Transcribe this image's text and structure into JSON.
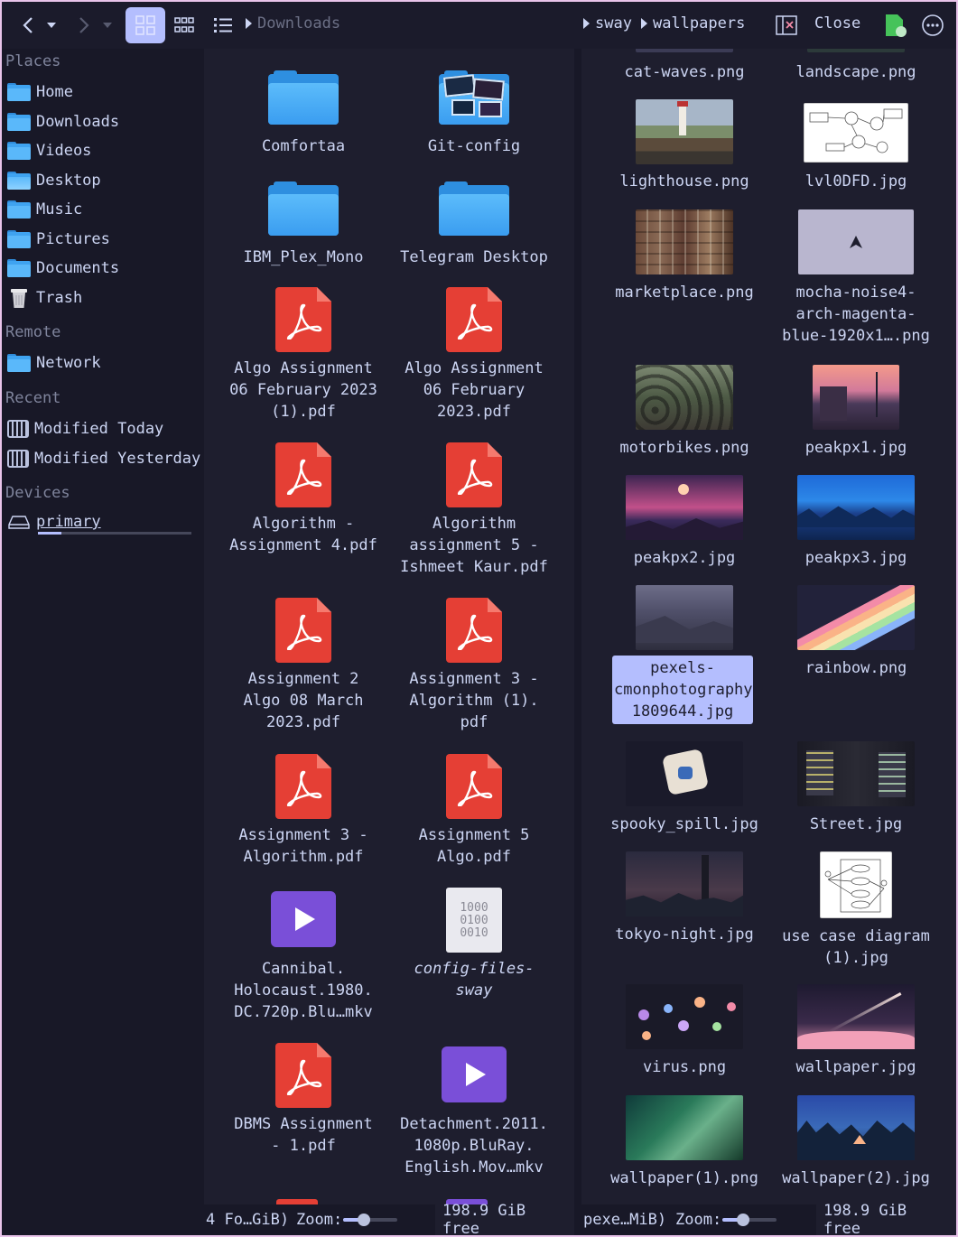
{
  "toolbar": {
    "path_placeholder": "Downloads",
    "crumb_1": "sway",
    "crumb_2": "wallpapers",
    "close_label": "Close"
  },
  "sidebar": {
    "places_header": "Places",
    "places": [
      "Home",
      "Downloads",
      "Videos",
      "Desktop",
      "Music",
      "Pictures",
      "Documents",
      "Trash"
    ],
    "remote_header": "Remote",
    "remote": [
      "Network"
    ],
    "recent_header": "Recent",
    "recent": [
      "Modified Today",
      "Modified Yesterday"
    ],
    "devices_header": "Devices",
    "devices": [
      "primary"
    ],
    "primary_usage": 0.15
  },
  "left_pane": {
    "items": [
      {
        "name": "Comfortaa",
        "type": "folder"
      },
      {
        "name": "Git-config",
        "type": "folder-images"
      },
      {
        "name": "IBM_Plex_Mono",
        "type": "folder"
      },
      {
        "name": "Telegram Desktop",
        "type": "folder"
      },
      {
        "name": "Algo Assignment\n06 February 2023\n(1).pdf",
        "type": "pdf"
      },
      {
        "name": "Algo Assignment\n06 February\n2023.pdf",
        "type": "pdf"
      },
      {
        "name": "Algorithm -\nAssignment 4.pdf",
        "type": "pdf"
      },
      {
        "name": "Algorithm\nassignment 5 -\nIshmeet Kaur.pdf",
        "type": "pdf"
      },
      {
        "name": "Assignment 2\nAlgo 08 March\n2023.pdf",
        "type": "pdf"
      },
      {
        "name": "Assignment 3 -\nAlgorithm (1).\npdf",
        "type": "pdf"
      },
      {
        "name": "Assignment 3 -\nAlgorithm.pdf",
        "type": "pdf"
      },
      {
        "name": "Assignment 5\nAlgo.pdf",
        "type": "pdf"
      },
      {
        "name": "Cannibal.\nHolocaust.1980.\nDC.720p.Blu…mkv",
        "type": "video"
      },
      {
        "name": "config-files-\nsway",
        "type": "binary"
      },
      {
        "name": "DBMS Assignment\n- 1.pdf",
        "type": "pdf"
      },
      {
        "name": "Detachment.2011.\n1080p.BluRay.\nEnglish.Mov…mkv",
        "type": "video"
      }
    ],
    "status_text": "4 Fo…GiB)",
    "zoom_label": "Zoom:",
    "free_space": "198.9 GiB free"
  },
  "right_pane": {
    "items": [
      {
        "name": "cat-waves.png"
      },
      {
        "name": "landscape.png"
      },
      {
        "name": "lighthouse.png"
      },
      {
        "name": "lvl0DFD.jpg"
      },
      {
        "name": "marketplace.png"
      },
      {
        "name": "mocha-noise4-\narch-magenta-\nblue-1920x1….png"
      },
      {
        "name": "motorbikes.png"
      },
      {
        "name": "peakpx1.jpg"
      },
      {
        "name": "peakpx2.jpg"
      },
      {
        "name": "peakpx3.jpg"
      },
      {
        "name": "pexels-\ncmonphotography-\n1809644.jpg"
      },
      {
        "name": "rainbow.png"
      },
      {
        "name": "spooky_spill.jpg"
      },
      {
        "name": "Street.jpg"
      },
      {
        "name": "tokyo-night.jpg"
      },
      {
        "name": "use case diagram\n(1).jpg"
      },
      {
        "name": "virus.png"
      },
      {
        "name": "wallpaper.jpg"
      },
      {
        "name": "wallpaper(1).png"
      },
      {
        "name": "wallpaper(2).jpg"
      }
    ],
    "status_text": "pexe…MiB)",
    "zoom_label": "Zoom:",
    "free_space": "198.9 GiB free"
  },
  "colors": {
    "accent": "#b4befe",
    "background": "#1e1e2e",
    "folder": "#3fa3f0",
    "pdf": "#e53f35",
    "video": "#7a4fd8"
  }
}
